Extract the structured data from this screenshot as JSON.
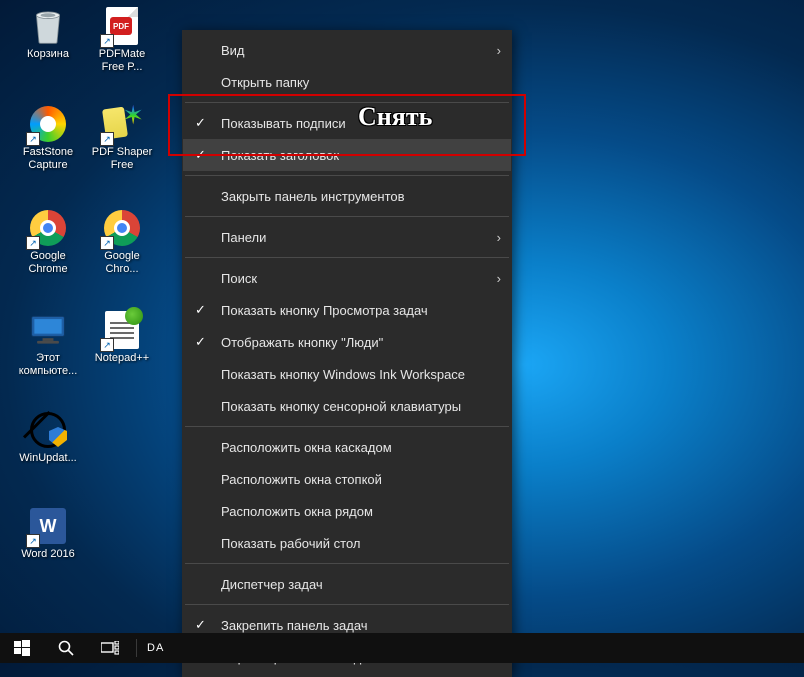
{
  "desktop_icons": [
    {
      "id": "recycle-bin",
      "label": "Корзина"
    },
    {
      "id": "pdfmate",
      "label": "PDFMate Free P..."
    },
    {
      "id": "faststone",
      "label": "FastStone Capture"
    },
    {
      "id": "pdfshaper",
      "label": "PDF Shaper Free"
    },
    {
      "id": "chrome",
      "label": "Google Chrome"
    },
    {
      "id": "chrome2",
      "label": "Google Chro..."
    },
    {
      "id": "this-pc",
      "label": "Этот компьюте..."
    },
    {
      "id": "notepadpp",
      "label": "Notepad++"
    },
    {
      "id": "winupdate",
      "label": "WinUpdat..."
    },
    {
      "id": "word",
      "label": "Word 2016"
    }
  ],
  "context_menu": {
    "groups": [
      [
        {
          "id": "view",
          "label": "Вид",
          "submenu": true,
          "checked": false
        },
        {
          "id": "open-folder",
          "label": "Открыть папку",
          "submenu": false,
          "checked": false
        }
      ],
      [
        {
          "id": "show-labels",
          "label": "Показывать подписи",
          "submenu": false,
          "checked": true
        },
        {
          "id": "show-title",
          "label": "Показать заголовок",
          "submenu": false,
          "checked": true
        }
      ],
      [
        {
          "id": "close-toolbar",
          "label": "Закрыть панель инструментов",
          "submenu": false,
          "checked": false
        }
      ],
      [
        {
          "id": "panels",
          "label": "Панели",
          "submenu": true,
          "checked": false
        }
      ],
      [
        {
          "id": "search",
          "label": "Поиск",
          "submenu": true,
          "checked": false
        },
        {
          "id": "task-view-btn",
          "label": "Показать кнопку Просмотра задач",
          "submenu": false,
          "checked": true
        },
        {
          "id": "people-btn",
          "label": "Отображать кнопку \"Люди\"",
          "submenu": false,
          "checked": true
        },
        {
          "id": "ink-btn",
          "label": "Показать кнопку Windows Ink Workspace",
          "submenu": false,
          "checked": false
        },
        {
          "id": "touch-kb-btn",
          "label": "Показать кнопку сенсорной клавиатуры",
          "submenu": false,
          "checked": false
        }
      ],
      [
        {
          "id": "cascade",
          "label": "Расположить окна каскадом",
          "submenu": false,
          "checked": false
        },
        {
          "id": "stack",
          "label": "Расположить окна стопкой",
          "submenu": false,
          "checked": false
        },
        {
          "id": "side-by-side",
          "label": "Расположить окна рядом",
          "submenu": false,
          "checked": false
        },
        {
          "id": "show-desktop",
          "label": "Показать рабочий стол",
          "submenu": false,
          "checked": false
        }
      ],
      [
        {
          "id": "task-manager",
          "label": "Диспетчер задач",
          "submenu": false,
          "checked": false
        }
      ],
      [
        {
          "id": "lock-taskbar",
          "label": "Закрепить панель задач",
          "submenu": false,
          "checked": true
        },
        {
          "id": "taskbar-settings",
          "label": "Параметры панели задач",
          "submenu": false,
          "checked": false,
          "gear": true
        }
      ]
    ]
  },
  "annotation": {
    "text": "Снять"
  },
  "taskbar": {
    "start": "⊞",
    "search": "⌕",
    "taskview": "⧉",
    "label": "DA"
  }
}
